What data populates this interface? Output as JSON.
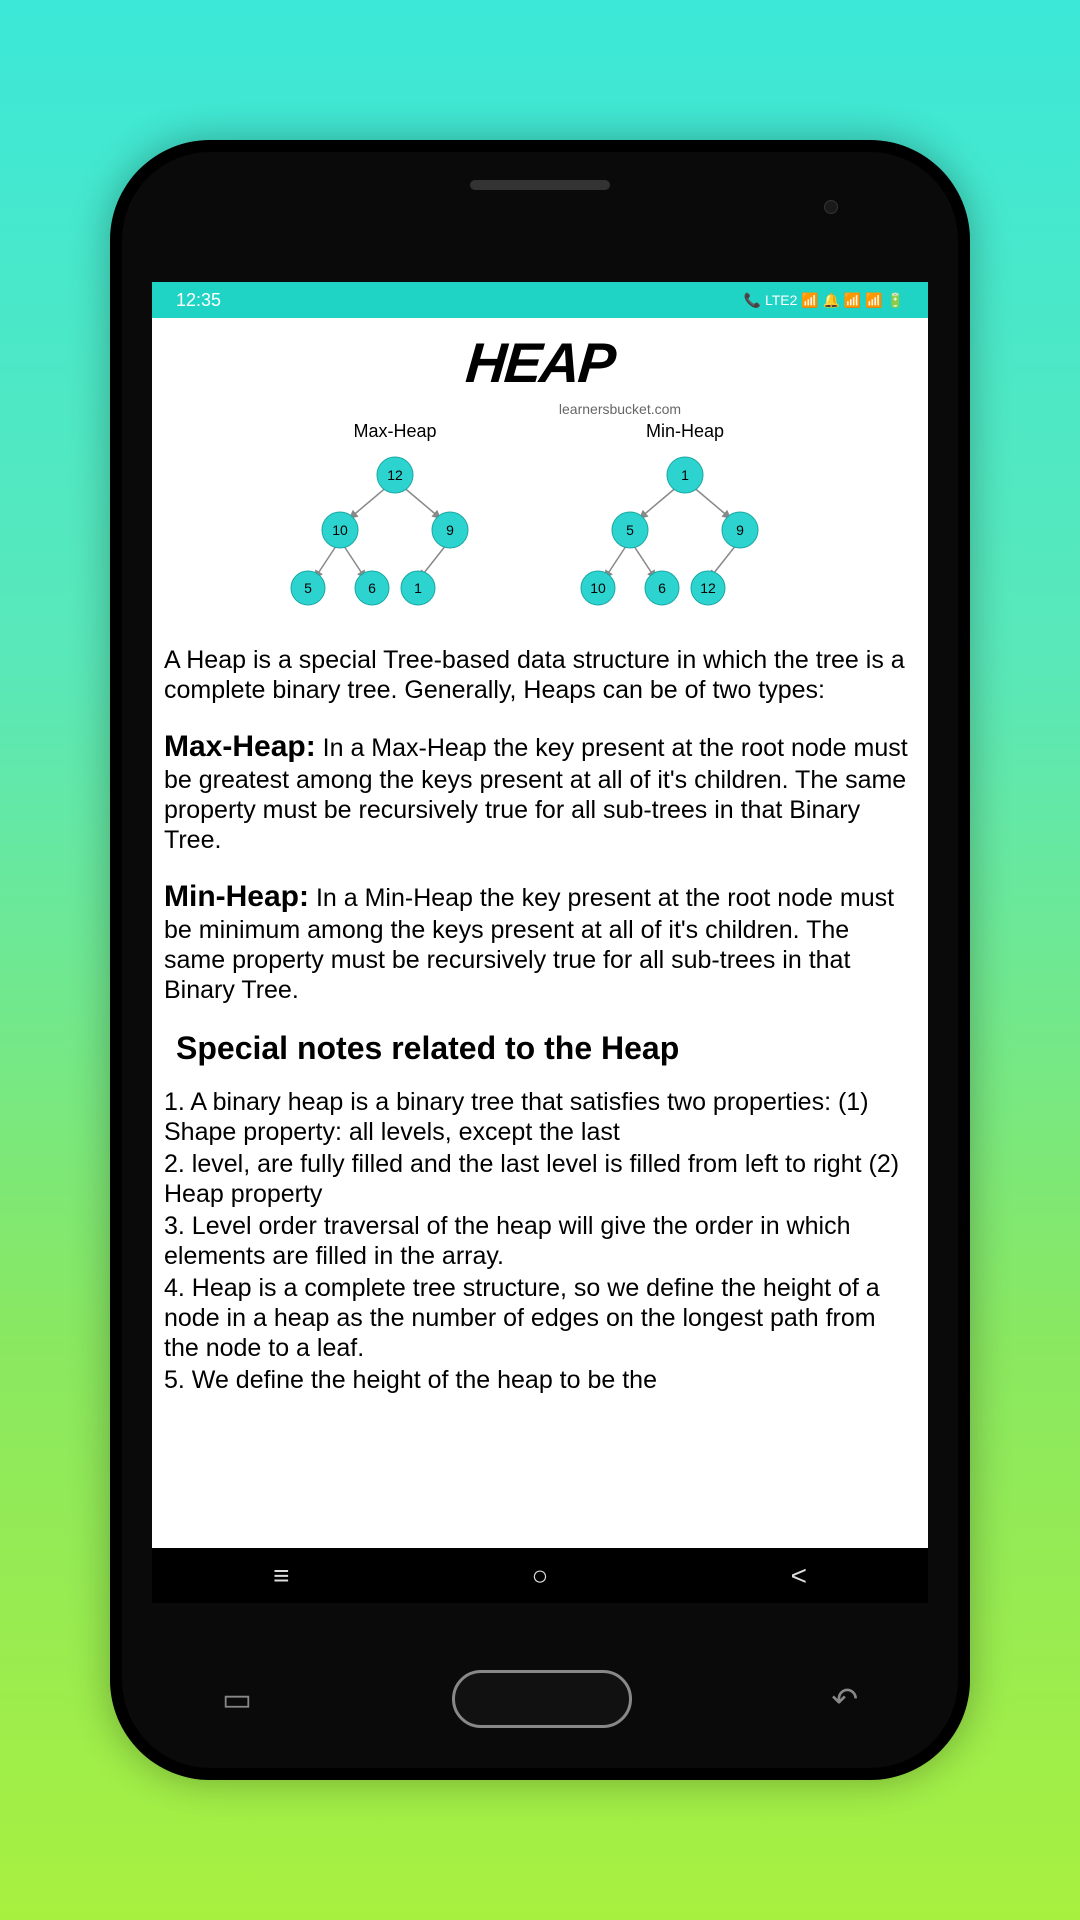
{
  "status": {
    "time": "12:35",
    "icons": "📞 LTE2 📶 🔔 📶 📶 🔋"
  },
  "title": "HEAP",
  "attribution": "learnersbucket.com",
  "diagrams": {
    "max": {
      "title": "Max-Heap",
      "nodes": [
        "12",
        "10",
        "9",
        "5",
        "6",
        "1"
      ]
    },
    "min": {
      "title": "Min-Heap",
      "nodes": [
        "1",
        "5",
        "9",
        "10",
        "6",
        "12"
      ]
    }
  },
  "intro": "A Heap is a special Tree-based data structure in which the tree is a complete binary tree. Generally, Heaps can be of two types:",
  "maxheap": {
    "label": "Max-Heap:",
    "text": " In a Max-Heap the key present at the root node must be greatest among the keys present at all of it's children. The same property must be recursively true for all sub-trees in that Binary Tree."
  },
  "minheap": {
    "label": "Min-Heap:",
    "text": " In a Min-Heap the key present at the root node must be minimum among the keys present at all of it's children. The same property must be recursively true for all sub-trees in that Binary Tree."
  },
  "notes_title": "Special notes related to the Heap",
  "notes": [
    "1. A binary heap is a binary tree that satisfies two properties: (1) Shape property: all levels, except the last",
    "2. level, are fully filled and the last level is filled from left to right (2) Heap property",
    "3. Level order traversal of the heap will give the order in which elements are filled in the array.",
    "4. Heap is a complete tree structure, so we define the height of a node in a heap as the number of edges on the longest path from the node to a leaf.",
    "5. We define the height of the heap to be the"
  ]
}
